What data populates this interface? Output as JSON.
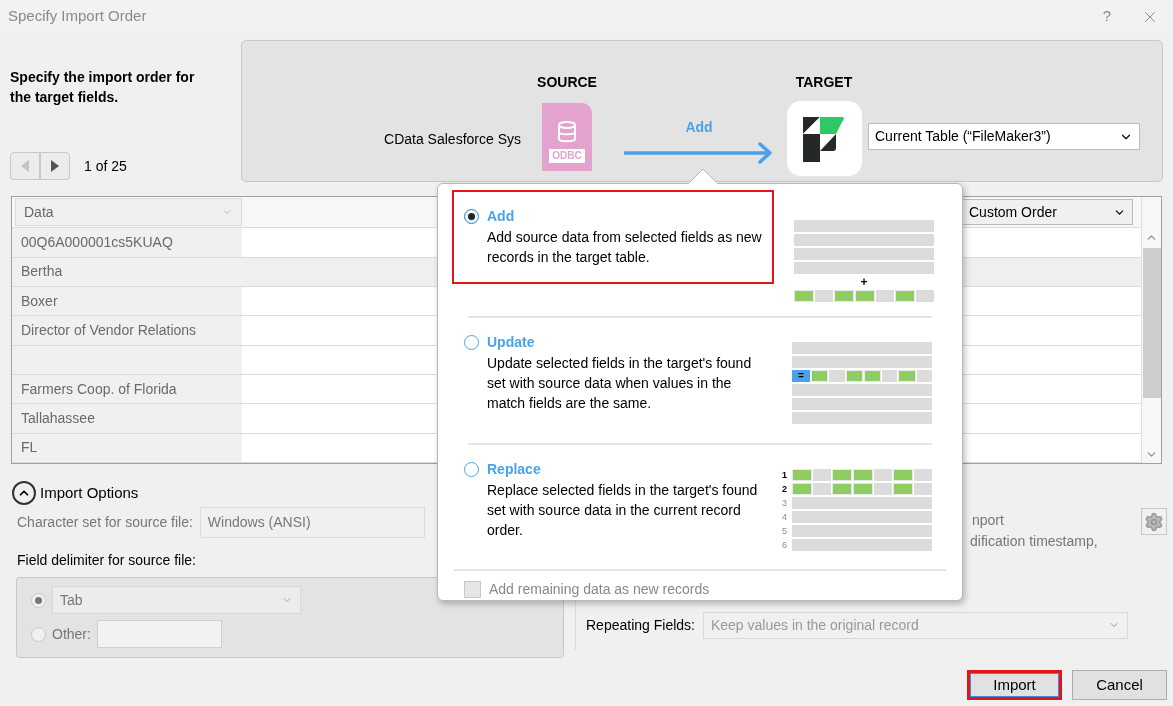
{
  "window": {
    "title": "Specify Import Order",
    "help": "?"
  },
  "header": {
    "instruction": "Specify the import order for the target fields.",
    "nav": [
      {
        "kind": "prev",
        "disabled": true
      },
      {
        "kind": "next",
        "disabled": false
      }
    ],
    "counter": "1 of 25"
  },
  "banner": {
    "source_label": "SOURCE",
    "source_name": "CData Salesforce Sys",
    "source_badge": "ODBC",
    "action": "Add",
    "target_label": "TARGET",
    "target_table": "Current Table (“FileMaker3”)"
  },
  "table": {
    "source_column": "Data",
    "order_select": "Custom Order",
    "rows": [
      {
        "value": "00Q6A000001cs5KUAQ",
        "selected": false
      },
      {
        "value": "Bertha",
        "selected": true
      },
      {
        "value": "Boxer",
        "selected": false
      },
      {
        "value": "Director of Vendor Relations",
        "selected": false
      },
      {
        "selected": false
      },
      {
        "value": "Farmers Coop. of Florida",
        "selected": false
      },
      {
        "value": "Tallahassee",
        "selected": false
      },
      {
        "value": "FL",
        "selected": false
      }
    ]
  },
  "import_options": {
    "label": "Import Options",
    "expanded": true,
    "charset_label": "Character set for source file:",
    "charset_value": "Windows (ANSI)",
    "delimiter_label": "Field delimiter for source file:",
    "delimiters": [
      {
        "kind": "select",
        "value": "Tab",
        "selected": true
      },
      {
        "kind": "input",
        "label": "Other:",
        "selected": false
      }
    ],
    "side_note_lines": [
      "nport",
      "dification timestamp,"
    ],
    "repeating_label": "Repeating Fields:",
    "repeating_value": "Keep values in the original record"
  },
  "popup": {
    "options": [
      {
        "title": "Add",
        "description": "Add source data from selected fields as new records in the target table.",
        "selected": true,
        "highlighted": true,
        "drawing": {
          "kind": "add",
          "marker": "+"
        }
      },
      {
        "title": "Update",
        "description": "Update selected fields in the target's found set with source data when values in the match fields are the same.",
        "selected": false,
        "highlighted": false,
        "drawing": {
          "kind": "update",
          "marker": "="
        }
      },
      {
        "title": "Replace",
        "description": "Replace selected fields in the target's found set with source data in the current record order.",
        "selected": false,
        "highlighted": false,
        "drawing": {
          "kind": "replace",
          "row_numbers": [
            "1",
            "2",
            "3",
            "4",
            "5",
            "6"
          ]
        }
      }
    ],
    "remaining": {
      "label": "Add remaining data as new records",
      "checked": false,
      "disabled": true
    }
  },
  "buttons": [
    {
      "label": "Import",
      "highlighted": true
    },
    {
      "label": "Cancel",
      "highlighted": false
    }
  ]
}
